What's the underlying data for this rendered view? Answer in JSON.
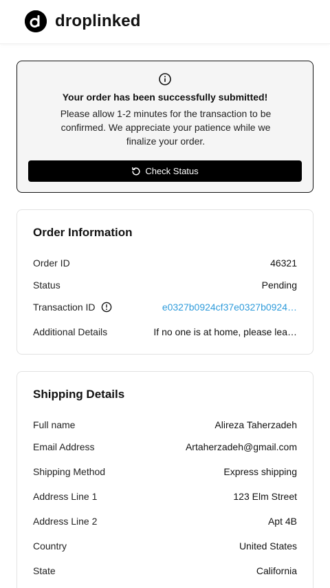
{
  "brand": {
    "name": "droplinked"
  },
  "notice": {
    "title": "Your order has been successfully submitted!",
    "message": "Please allow 1-2 minutes for the transaction to be confirmed. We appreciate your patience while we finalize your order.",
    "button_label": "Check Status"
  },
  "order": {
    "title": "Order Information",
    "rows": [
      {
        "label": "Order ID",
        "value": "46321"
      },
      {
        "label": "Status",
        "value": "Pending"
      },
      {
        "label": "Transaction ID",
        "value": "e0327b0924cf37e0327b0924…"
      },
      {
        "label": "Additional Details",
        "value": "If no one is at home, please lea…"
      }
    ]
  },
  "shipping": {
    "title": "Shipping Details",
    "rows": [
      {
        "label": "Full name",
        "value": "Alireza Taherzadeh"
      },
      {
        "label": "Email Address",
        "value": "Artaherzadeh@gmail.com"
      },
      {
        "label": "Shipping Method",
        "value": "Express shipping"
      },
      {
        "label": "Address Line 1",
        "value": "123 Elm Street"
      },
      {
        "label": "Address Line 2",
        "value": "Apt 4B"
      },
      {
        "label": "Country",
        "value": "United States"
      },
      {
        "label": "State",
        "value": "California"
      }
    ]
  },
  "colors": {
    "link": "#2e9bdb",
    "button": "#000000",
    "notice_bg": "#f5f5f5"
  }
}
